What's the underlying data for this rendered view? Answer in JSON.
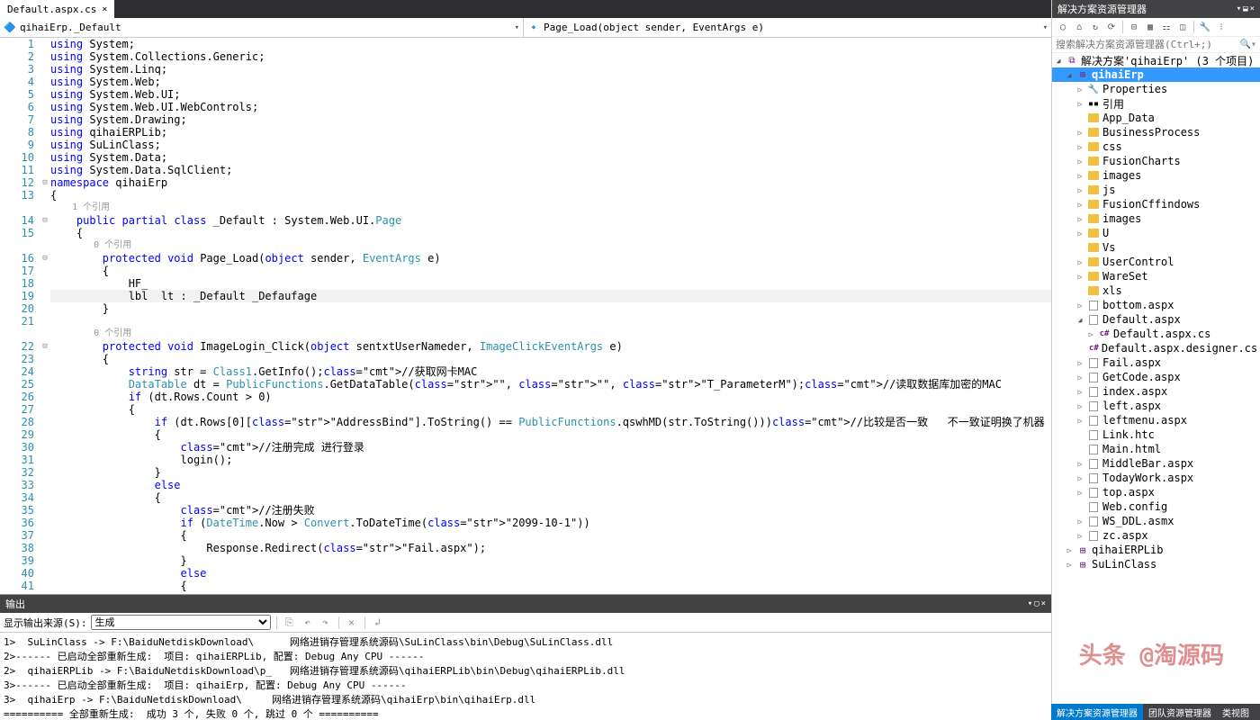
{
  "tab": {
    "label": "Default.aspx.cs",
    "close": "×"
  },
  "crumbs": {
    "left": "qihaiErp._Default",
    "right": "Page_Load(object sender, EventArgs e)"
  },
  "code": {
    "lines": [
      {
        "n": 1,
        "t": "using System;"
      },
      {
        "n": 2,
        "t": "using System.Collections.Generic;"
      },
      {
        "n": 3,
        "t": "using System.Linq;"
      },
      {
        "n": 4,
        "t": "using System.Web;"
      },
      {
        "n": 5,
        "t": "using System.Web.UI;"
      },
      {
        "n": 6,
        "t": "using System.Web.UI.WebControls;"
      },
      {
        "n": 7,
        "t": "using System.Drawing;"
      },
      {
        "n": 8,
        "t": "using qihaiERPLib;"
      },
      {
        "n": 9,
        "t": "using SuLinClass;"
      },
      {
        "n": 10,
        "t": "using System.Data;"
      },
      {
        "n": 11,
        "t": "using System.Data.SqlClient;"
      },
      {
        "n": 12,
        "t": "namespace qihaiErp"
      },
      {
        "n": 13,
        "t": "{"
      },
      {
        "n": "",
        "t": "    1 个引用",
        "ref": true
      },
      {
        "n": 14,
        "t": "    public partial class _Default : System.Web.UI.Page"
      },
      {
        "n": 15,
        "t": "    {"
      },
      {
        "n": "",
        "t": "        0 个引用",
        "ref": true
      },
      {
        "n": 16,
        "t": "        protected void Page_Load(object sender, EventArgs e)"
      },
      {
        "n": 17,
        "t": "        {"
      },
      {
        "n": 18,
        "t": "            HF_"
      },
      {
        "n": 19,
        "t": "            lbl  lt : _Default _Defaufage",
        "caret": true
      },
      {
        "n": 20,
        "t": "        }"
      },
      {
        "n": 21,
        "t": ""
      },
      {
        "n": "",
        "t": "        0 个引用",
        "ref": true
      },
      {
        "n": 22,
        "t": "        protected void ImageLogin_Click(object sentxtUserNameder, ImageClickEventArgs e)"
      },
      {
        "n": 23,
        "t": "        {"
      },
      {
        "n": 24,
        "t": "            string str = Class1.GetInfo();//获取网卡MAC"
      },
      {
        "n": 25,
        "t": "            DataTable dt = PublicFunctions.GetDataTable(\"\", \"\", \"T_ParameterM\");//读取数据库加密的MAC"
      },
      {
        "n": 26,
        "t": "            if (dt.Rows.Count > 0)"
      },
      {
        "n": 27,
        "t": "            {"
      },
      {
        "n": 28,
        "t": "                if (dt.Rows[0][\"AddressBind\"].ToString() == PublicFunctions.qswhMD(str.ToString()))//比较是否一致   不一致证明换了机器"
      },
      {
        "n": 29,
        "t": "                {"
      },
      {
        "n": 30,
        "t": "                    //注册完成 进行登录"
      },
      {
        "n": 31,
        "t": "                    login();"
      },
      {
        "n": 32,
        "t": "                }"
      },
      {
        "n": 33,
        "t": "                else"
      },
      {
        "n": 34,
        "t": "                {"
      },
      {
        "n": 35,
        "t": "                    //注册失败"
      },
      {
        "n": 36,
        "t": "                    if (DateTime.Now > Convert.ToDateTime(\"2099-10-1\"))"
      },
      {
        "n": 37,
        "t": "                    {"
      },
      {
        "n": 38,
        "t": "                        Response.Redirect(\"Fail.aspx\");"
      },
      {
        "n": 39,
        "t": "                    }"
      },
      {
        "n": 40,
        "t": "                    else"
      },
      {
        "n": 41,
        "t": "                    {"
      }
    ]
  },
  "output": {
    "title": "输出",
    "source_label": "显示输出来源(S):",
    "source_value": "生成",
    "text": "1>  SuLinClass -> F:\\BaiduNetdiskDownload\\      网络进销存管理系统源码\\SuLinClass\\bin\\Debug\\SuLinClass.dll\n2>------ 已启动全部重新生成:  项目: qihaiERPLib, 配置: Debug Any CPU ------\n2>  qihaiERPLib -> F:\\BaiduNetdiskDownload\\p_   网络进销存管理系统源码\\qihaiERPLib\\bin\\Debug\\qihaiERPLib.dll\n3>------ 已启动全部重新生成:  项目: qihaiErp, 配置: Debug Any CPU ------\n3>  qihaiErp -> F:\\BaiduNetdiskDownload\\     网络进销存管理系统源码\\qihaiErp\\bin\\qihaiErp.dll\n========== 全部重新生成:  成功 3 个, 失败 0 个, 跳过 0 个 =========="
  },
  "se": {
    "title": "解决方案资源管理器",
    "search_placeholder": "搜索解决方案资源管理器(Ctrl+;)",
    "root": "解决方案'qihaiErp' (3 个项目)",
    "project": "qihaiErp",
    "nodes": [
      {
        "d": 2,
        "arrow": "▷",
        "icon": "wrench",
        "label": "Properties"
      },
      {
        "d": 2,
        "arrow": "▷",
        "icon": "ref",
        "label": "引用"
      },
      {
        "d": 2,
        "arrow": "",
        "icon": "folder",
        "label": "App_Data"
      },
      {
        "d": 2,
        "arrow": "▷",
        "icon": "folder",
        "label": "BusinessProcess"
      },
      {
        "d": 2,
        "arrow": "▷",
        "icon": "folder",
        "label": "css"
      },
      {
        "d": 2,
        "arrow": "▷",
        "icon": "folder",
        "label": "FusionCharts"
      },
      {
        "d": 2,
        "arrow": "▷",
        "icon": "folder",
        "label": "images"
      },
      {
        "d": 2,
        "arrow": "▷",
        "icon": "folder",
        "label": "js"
      },
      {
        "d": 2,
        "arrow": "▷",
        "icon": "folder",
        "label": "FusionCffindows"
      },
      {
        "d": 2,
        "arrow": "▷",
        "icon": "folder",
        "label": "images"
      },
      {
        "d": 2,
        "arrow": "▷",
        "icon": "folder",
        "label": "U"
      },
      {
        "d": 2,
        "arrow": "",
        "icon": "folder",
        "label": "Vs"
      },
      {
        "d": 2,
        "arrow": "▷",
        "icon": "folder",
        "label": "UserControl"
      },
      {
        "d": 2,
        "arrow": "▷",
        "icon": "folder",
        "label": "WareSet"
      },
      {
        "d": 2,
        "arrow": "",
        "icon": "folder",
        "label": "xls"
      },
      {
        "d": 2,
        "arrow": "▷",
        "icon": "file",
        "label": "bottom.aspx"
      },
      {
        "d": 2,
        "arrow": "◢",
        "icon": "file",
        "label": "Default.aspx"
      },
      {
        "d": 3,
        "arrow": "▷",
        "icon": "cs",
        "label": "Default.aspx.cs"
      },
      {
        "d": 3,
        "arrow": "",
        "icon": "cs",
        "label": "Default.aspx.designer.cs"
      },
      {
        "d": 2,
        "arrow": "▷",
        "icon": "file",
        "label": "Fail.aspx"
      },
      {
        "d": 2,
        "arrow": "▷",
        "icon": "file",
        "label": "GetCode.aspx"
      },
      {
        "d": 2,
        "arrow": "▷",
        "icon": "file",
        "label": "index.aspx"
      },
      {
        "d": 2,
        "arrow": "▷",
        "icon": "file",
        "label": "left.aspx"
      },
      {
        "d": 2,
        "arrow": "▷",
        "icon": "file",
        "label": "leftmenu.aspx"
      },
      {
        "d": 2,
        "arrow": "",
        "icon": "file",
        "label": "Link.htc"
      },
      {
        "d": 2,
        "arrow": "",
        "icon": "file",
        "label": "Main.html"
      },
      {
        "d": 2,
        "arrow": "▷",
        "icon": "file",
        "label": "MiddleBar.aspx"
      },
      {
        "d": 2,
        "arrow": "▷",
        "icon": "file",
        "label": "TodayWork.aspx"
      },
      {
        "d": 2,
        "arrow": "▷",
        "icon": "file",
        "label": "top.aspx"
      },
      {
        "d": 2,
        "arrow": "",
        "icon": "file",
        "label": "Web.config"
      },
      {
        "d": 2,
        "arrow": "▷",
        "icon": "file",
        "label": "WS_DDL.asmx"
      },
      {
        "d": 2,
        "arrow": "▷",
        "icon": "file",
        "label": "zc.aspx"
      },
      {
        "d": 1,
        "arrow": "▷",
        "icon": "proj",
        "label": "qihaiERPLib"
      },
      {
        "d": 1,
        "arrow": "▷",
        "icon": "proj",
        "label": "SuLinClass"
      }
    ]
  },
  "status": {
    "tabs": [
      "解决方案资源管理器",
      "团队资源管理器",
      "类视图"
    ]
  },
  "watermark": "头条 @淘源码"
}
